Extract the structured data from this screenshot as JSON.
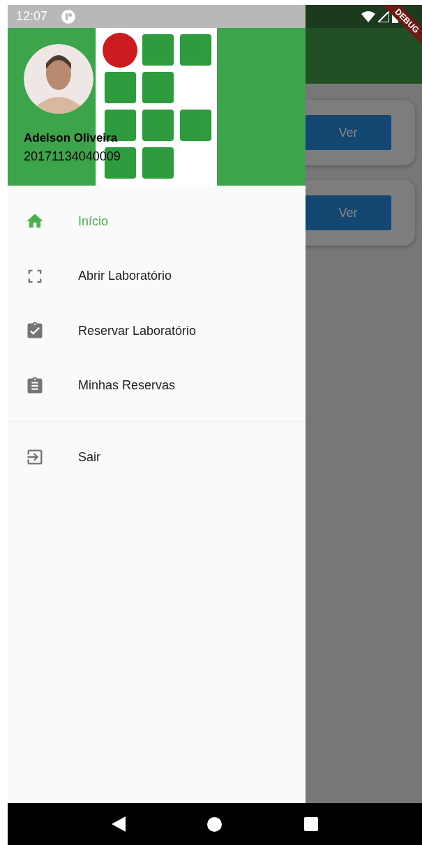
{
  "status_bar": {
    "time": "12:07"
  },
  "debug_banner": {
    "label": "DEBUG"
  },
  "drawer": {
    "header": {
      "name": "Adelson Oliveira",
      "registration": "20171134040009"
    },
    "items": [
      {
        "label": "Início",
        "kind": "home",
        "selected": true
      },
      {
        "label": "Abrir Laboratório",
        "kind": "scan",
        "selected": false
      },
      {
        "label": "Reservar Laboratório",
        "kind": "clipboard-check",
        "selected": false
      },
      {
        "label": "Minhas Reservas",
        "kind": "clipboard-list",
        "selected": false
      }
    ],
    "footer_items": [
      {
        "label": "Sair",
        "kind": "exit",
        "selected": false
      }
    ]
  },
  "background": {
    "cards": [
      {
        "button": "Ver"
      },
      {
        "button": "Ver"
      }
    ]
  }
}
